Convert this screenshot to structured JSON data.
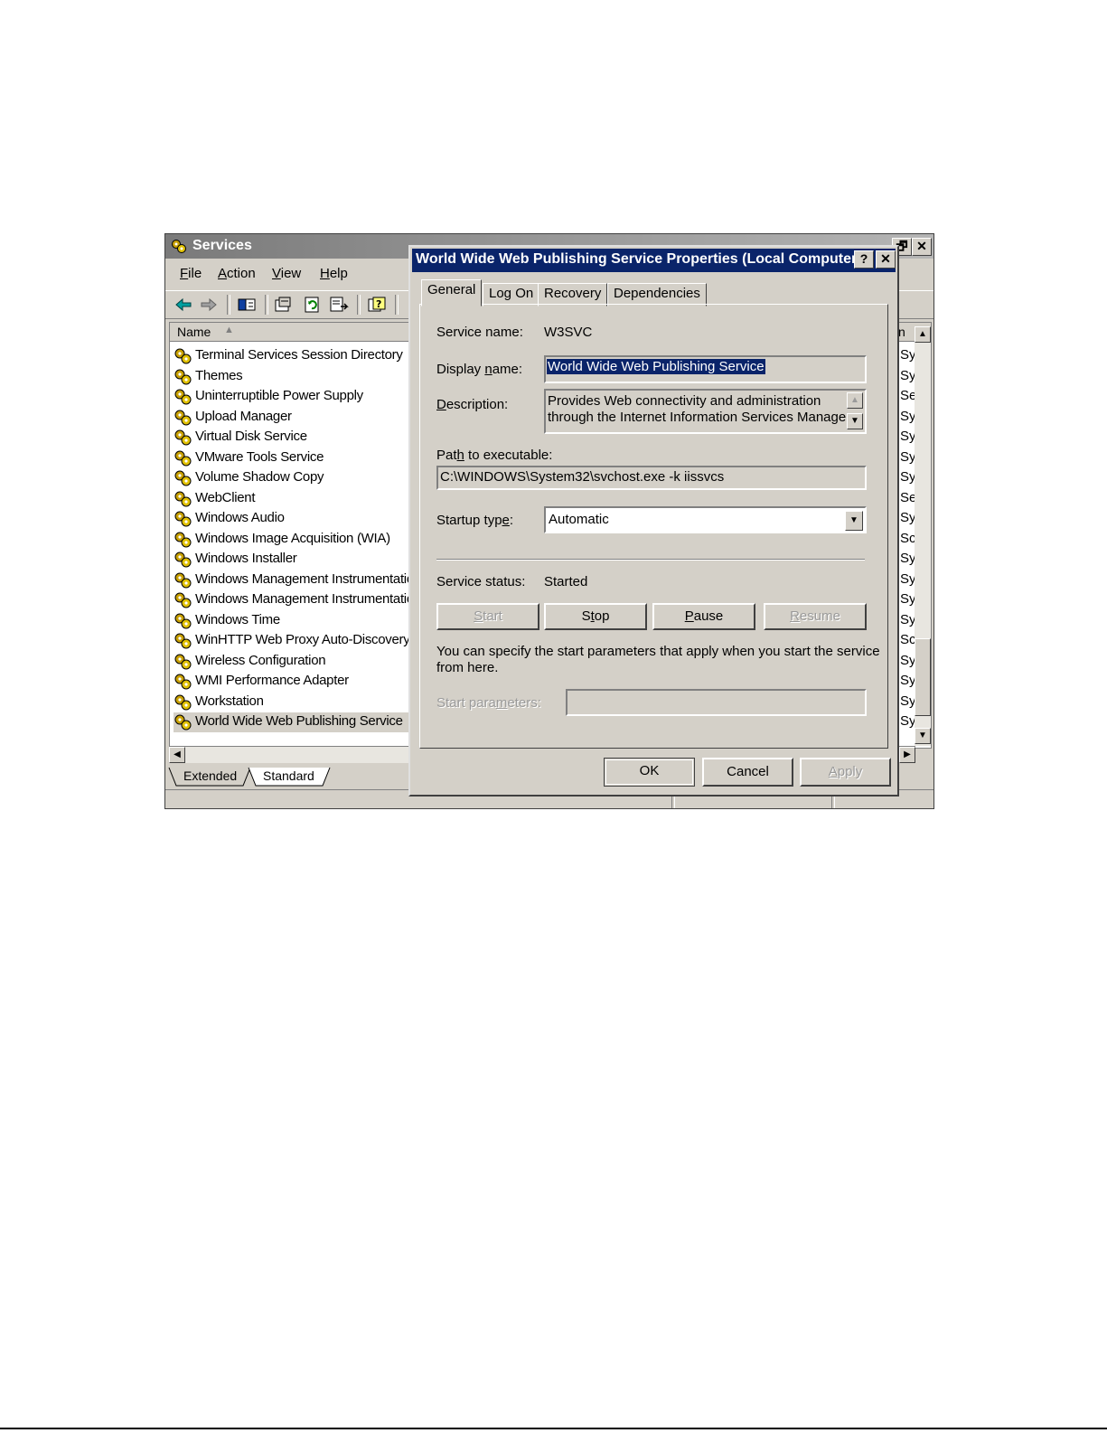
{
  "services_window": {
    "title": "Services",
    "menu": [
      {
        "accel": "F",
        "rest": "ile"
      },
      {
        "accel": "A",
        "rest": "ction"
      },
      {
        "accel": "V",
        "rest": "iew"
      },
      {
        "accel": "H",
        "rest": "elp"
      }
    ],
    "list_header": {
      "name": "Name",
      "right_col": "n"
    },
    "rows": [
      {
        "name": "Terminal Services Session Directory",
        "right": "Sy"
      },
      {
        "name": "Themes",
        "right": "Sy"
      },
      {
        "name": "Uninterruptible Power Supply",
        "right": "Se"
      },
      {
        "name": "Upload Manager",
        "right": "Sy"
      },
      {
        "name": "Virtual Disk Service",
        "right": "Sy"
      },
      {
        "name": "VMware Tools Service",
        "right": "Sy"
      },
      {
        "name": "Volume Shadow Copy",
        "right": "Sy"
      },
      {
        "name": "WebClient",
        "right": "Se"
      },
      {
        "name": "Windows Audio",
        "right": "Sy"
      },
      {
        "name": "Windows Image Acquisition (WIA)",
        "right": "Sc"
      },
      {
        "name": "Windows Installer",
        "right": "Sy"
      },
      {
        "name": "Windows Management Instrumentatio",
        "right": "Sy"
      },
      {
        "name": "Windows Management Instrumentatio",
        "right": "Sy"
      },
      {
        "name": "Windows Time",
        "right": "Sy"
      },
      {
        "name": "WinHTTP Web Proxy Auto-Discovery",
        "right": "Sc"
      },
      {
        "name": "Wireless Configuration",
        "right": "Sy"
      },
      {
        "name": "WMI Performance Adapter",
        "right": "Sy"
      },
      {
        "name": "Workstation",
        "right": "Sy"
      },
      {
        "name": "World Wide Web Publishing Service",
        "right": "Sy"
      }
    ],
    "bottom_tabs": [
      "Extended",
      "Standard"
    ]
  },
  "dialog": {
    "title": "World Wide Web Publishing Service Properties (Local Computer)",
    "help_glyph": "?",
    "close_glyph": "✕",
    "tabs": [
      "General",
      "Log On",
      "Recovery",
      "Dependencies"
    ],
    "service_name_label": "Service name:",
    "service_name": "W3SVC",
    "display_name_label_pre": "Display ",
    "display_name_label_accel": "n",
    "display_name_label_post": "ame:",
    "display_name": "World Wide Web Publishing Service",
    "description_label_accel": "D",
    "description_label_post": "escription:",
    "description_line1": "Provides Web connectivity and administration",
    "description_line2": "through the Internet Information Services Manager",
    "path_label_pre": "Pat",
    "path_label_accel": "h",
    "path_label_post": " to executable:",
    "path": "C:\\WINDOWS\\System32\\svchost.exe -k iissvcs",
    "startup_label_pre": "Startup typ",
    "startup_label_accel": "e",
    "startup_label_post": ":",
    "startup_value": "Automatic",
    "status_label": "Service status:",
    "status_value": "Started",
    "buttons": {
      "start": {
        "accel": "S",
        "rest": "tart"
      },
      "stop_pre": "S",
      "stop_accel": "t",
      "stop_post": "op",
      "pause": {
        "accel": "P",
        "rest": "ause"
      },
      "resume": {
        "accel": "R",
        "rest": "esume"
      }
    },
    "info_line1": "You can specify the start parameters that apply when you start the service",
    "info_line2": "from here.",
    "start_params_label_pre": "Start para",
    "start_params_label_accel": "m",
    "start_params_label_post": "eters:",
    "ok": "OK",
    "cancel": "Cancel",
    "apply_accel": "A",
    "apply_rest": "pply"
  }
}
